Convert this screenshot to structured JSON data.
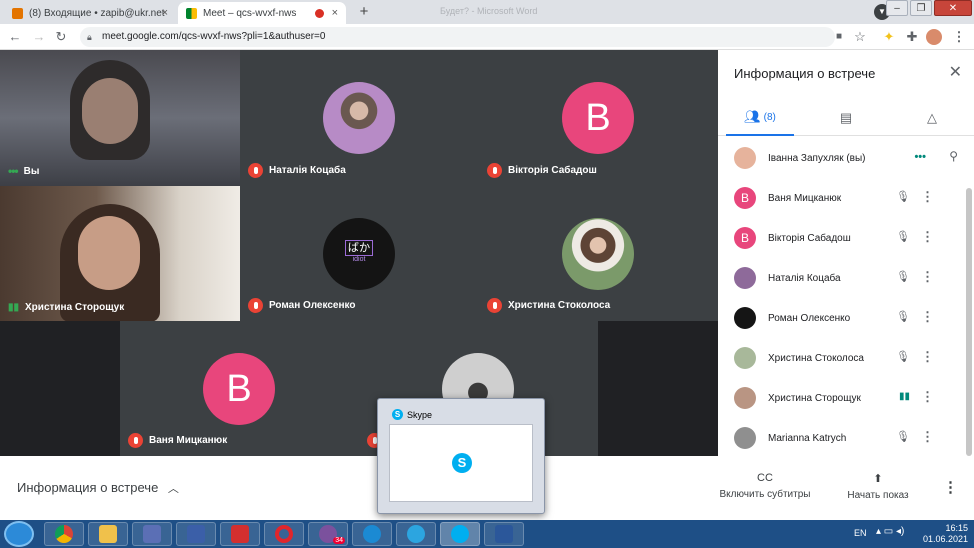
{
  "browser": {
    "tabs": [
      {
        "title": "(8) Входящие • zapib@ukr.net",
        "close": "×"
      },
      {
        "title": "Meet – qcs-wvxf-nws",
        "close": "×"
      }
    ],
    "new_tab": "+",
    "window_title": "Будет? - Microsoft Word",
    "url": "meet.google.com/qcs-wvxf-nws?pli=1&authuser=0"
  },
  "meet": {
    "tiles": [
      {
        "name": "Вы"
      },
      {
        "name": "Наталія Коцаба"
      },
      {
        "name": "Вікторія Сабадош",
        "initial": "В"
      },
      {
        "name": "Христина Сторощук"
      },
      {
        "name": "Роман Олексенко",
        "logo_text": "ばか",
        "logo_sub": "idiot"
      },
      {
        "name": "Христина Стоколоса"
      },
      {
        "name": "Ваня Мицканюк",
        "initial": "В"
      }
    ],
    "avatar_color": "#e8467c"
  },
  "panel": {
    "title": "Информация о встрече",
    "people_count": "(8)",
    "participants": [
      {
        "name": "Іванна Запухляк (вы)",
        "initial": ""
      },
      {
        "name": "Ваня Мицканюк",
        "initial": "В"
      },
      {
        "name": "Вікторія Сабадош",
        "initial": "В"
      },
      {
        "name": "Наталія Коцаба",
        "initial": ""
      },
      {
        "name": "Роман Олексенко",
        "initial": ""
      },
      {
        "name": "Христина Стоколоса",
        "initial": ""
      },
      {
        "name": "Христина Сторощук",
        "initial": ""
      },
      {
        "name": "Marianna Katrych",
        "initial": ""
      }
    ]
  },
  "bottom": {
    "info_label": "Информация о встрече",
    "captions_label": "Включить субтитры",
    "captions_icon": "CC",
    "present_label": "Начать показ"
  },
  "skype": {
    "title": "Skype",
    "logo": "S"
  },
  "taskbar": {
    "lang": "EN",
    "time": "16:15",
    "date": "01.06.2021",
    "viber_badge": "34"
  }
}
